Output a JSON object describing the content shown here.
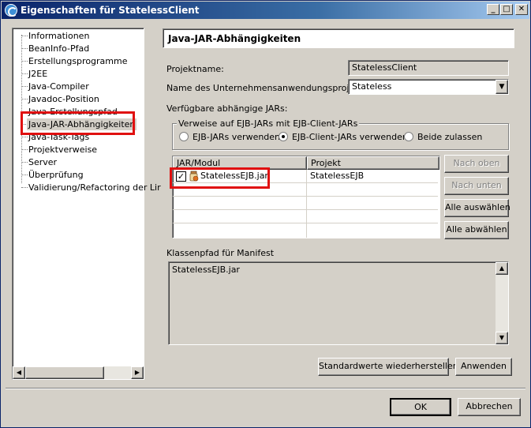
{
  "window": {
    "title": "Eigenschaften für StatelessClient",
    "controls": {
      "minimize": "_",
      "maximize": "□",
      "close": "✕"
    }
  },
  "tree": {
    "items": [
      "Informationen",
      "BeanInfo-Pfad",
      "Erstellungsprogramme",
      "J2EE",
      "Java-Compiler",
      "Javadoc-Position",
      "Java-Erstellungspfad",
      "Java-JAR-Abhängigkeiten",
      "Java-Task-Tags",
      "Projektverweise",
      "Server",
      "Überprüfung",
      "Validierung/Refactoring der Lir"
    ],
    "selected_index": 7
  },
  "page": {
    "header": "Java-JAR-Abhängigkeiten",
    "project_name_label": "Projektname:",
    "project_name_value": "StatelessClient",
    "enterprise_app_label": "Name des Unternehmensanwendungsprojekts:",
    "enterprise_app_value": "Stateless",
    "available_jars_label": "Verfügbare abhängige JARs:",
    "group_title": "Verweise auf EJB-JARs mit EJB-Client-JARs",
    "radio_options": [
      {
        "label": "EJB-JARs verwenden",
        "checked": false
      },
      {
        "label": "EJB-Client-JARs verwenden",
        "checked": true
      },
      {
        "label": "Beide zulassen",
        "checked": false
      }
    ],
    "table": {
      "columns": [
        "JAR/Modul",
        "Projekt"
      ],
      "rows": [
        {
          "checked": true,
          "jar": "StatelessEJB.jar",
          "project": "StatelessEJB"
        }
      ]
    },
    "buttons": {
      "move_up": "Nach oben",
      "move_down": "Nach unten",
      "select_all": "Alle auswählen",
      "deselect_all": "Alle abwählen",
      "restore_defaults": "Standardwerte wiederherstellen",
      "apply": "Anwenden"
    },
    "manifest_label": "Klassenpfad für Manifest",
    "manifest_value": "StatelessEJB.jar"
  },
  "dialog_buttons": {
    "ok": "OK",
    "cancel": "Abbrechen"
  },
  "colors": {
    "highlight": "#e01010",
    "titlebar": "#0a246a"
  }
}
